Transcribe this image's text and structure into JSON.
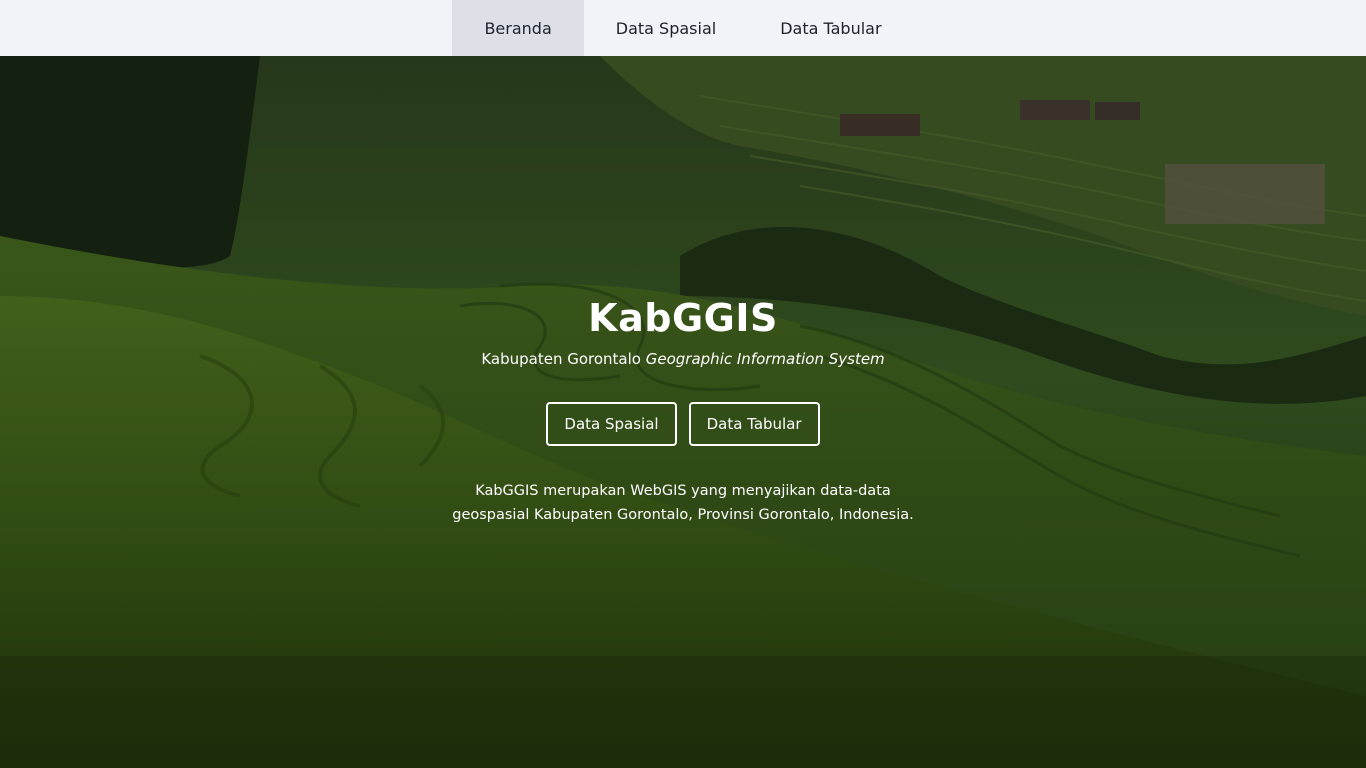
{
  "nav": {
    "items": [
      {
        "label": "Beranda",
        "active": true
      },
      {
        "label": "Data Spasial",
        "active": false
      },
      {
        "label": "Data Tabular",
        "active": false
      }
    ]
  },
  "hero": {
    "title": "KabGGIS",
    "subtitle_plain": "Kabupaten Gorontalo",
    "subtitle_italic": "Geographic Information System",
    "buttons": {
      "spasial": "Data Spasial",
      "tabular": "Data Tabular"
    },
    "description_line1": "KabGGIS merupakan WebGIS yang menyajikan data-data",
    "description_line2": "geospasial Kabupaten Gorontalo, Provinsi Gorontalo, Indonesia."
  },
  "colors": {
    "navbar_bg": "#f0f3f7",
    "nav_active_bg": "#dde1e7",
    "hero_text": "#ffffff"
  }
}
